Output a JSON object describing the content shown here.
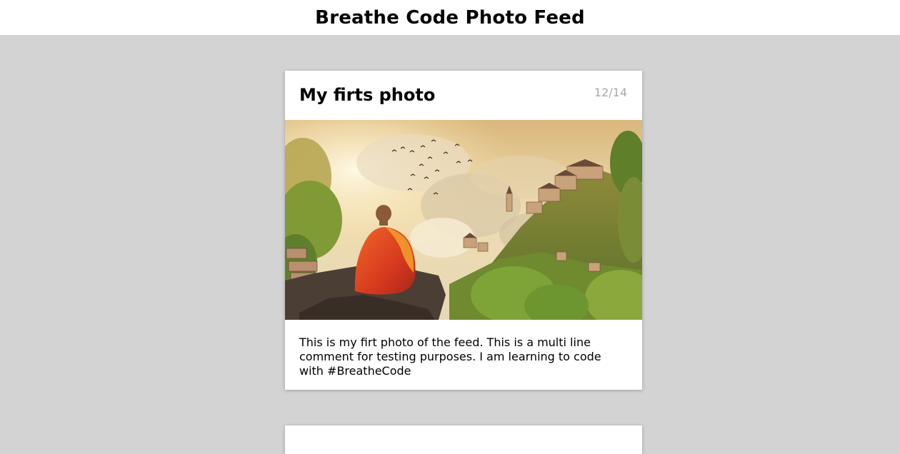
{
  "header": {
    "title": "Breathe Code Photo Feed"
  },
  "feed": {
    "posts": [
      {
        "title": "My firts photo",
        "date": "12/14",
        "caption": "This is my firt photo of the feed. This is a multi line comment for testing purposes. I am learning to code with #BreatheCode"
      }
    ]
  }
}
